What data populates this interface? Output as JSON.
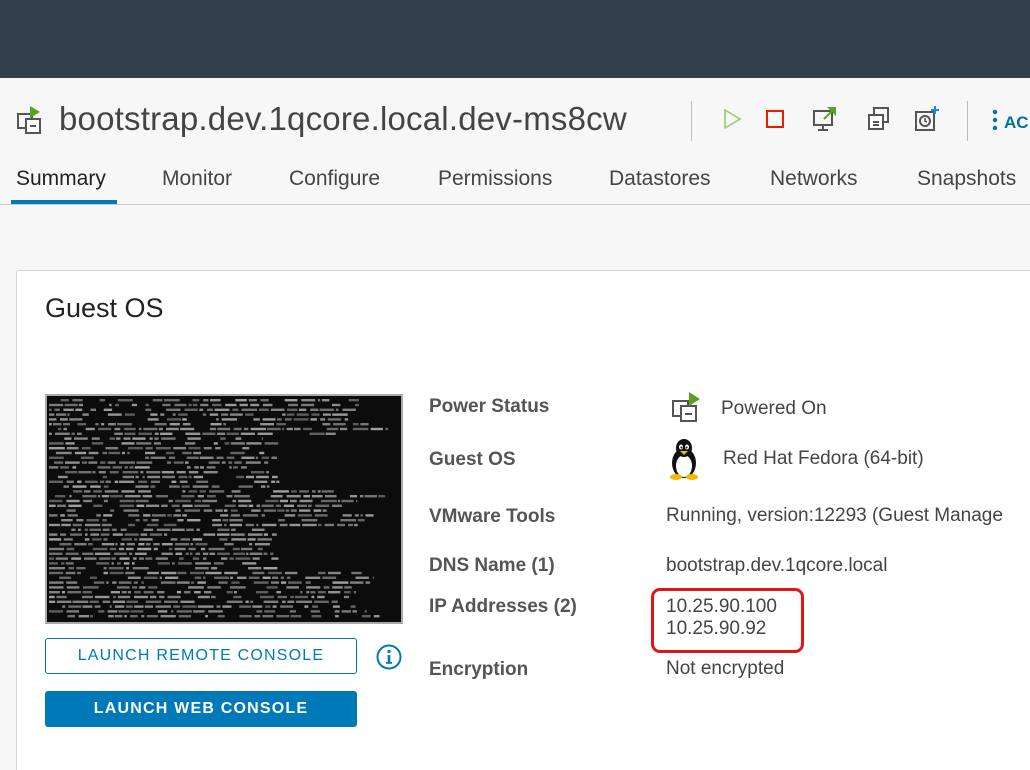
{
  "header": {
    "vm_name": "bootstrap.dev.1qcore.local.dev-ms8cw",
    "actions_label": "AC",
    "toolbar_icons": [
      "power-on-icon",
      "power-off-icon",
      "launch-console-icon",
      "migrate-icon",
      "snapshot-icon"
    ]
  },
  "tabs": [
    {
      "label": "Summary",
      "active": true
    },
    {
      "label": "Monitor",
      "active": false
    },
    {
      "label": "Configure",
      "active": false
    },
    {
      "label": "Permissions",
      "active": false
    },
    {
      "label": "Datastores",
      "active": false
    },
    {
      "label": "Networks",
      "active": false
    },
    {
      "label": "Snapshots",
      "active": false
    }
  ],
  "guest_os_card": {
    "title": "Guest OS",
    "launch_remote_console": "LAUNCH REMOTE CONSOLE",
    "launch_web_console": "LAUNCH WEB CONSOLE",
    "properties": {
      "power_status": {
        "label": "Power Status",
        "value": "Powered On",
        "icon": "powered-on-vm-icon"
      },
      "guest_os": {
        "label": "Guest OS",
        "value": "Red Hat Fedora (64-bit)",
        "icon": "linux-tux-icon"
      },
      "vmware_tools": {
        "label": "VMware Tools",
        "value": "Running, version:12293 (Guest Manage"
      },
      "dns_name": {
        "label": "DNS Name (1)",
        "value": "bootstrap.dev.1qcore.local"
      },
      "ip_addresses": {
        "label": "IP Addresses (2)",
        "values": [
          "10.25.90.100",
          "10.25.90.92"
        ]
      },
      "encryption": {
        "label": "Encryption",
        "value": "Not encrypted"
      }
    }
  },
  "colors": {
    "topbar": "#313f4d",
    "accent": "#0079b8",
    "power_on_green": "#5aa220",
    "power_off_red": "#e12200",
    "highlight_red": "#e31414"
  }
}
